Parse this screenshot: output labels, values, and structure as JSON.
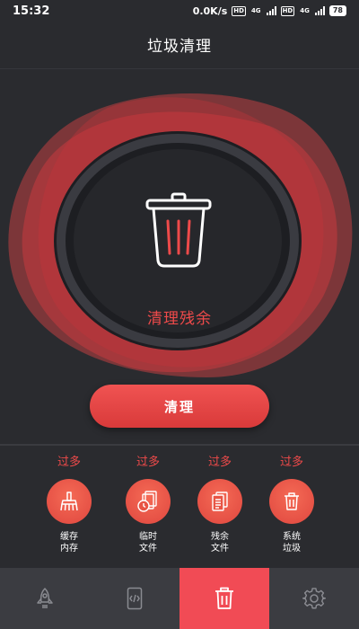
{
  "status_bar": {
    "time": "15:32",
    "speed": "0.0K/s",
    "hd1": "HD",
    "net1": "4G",
    "hd2": "HD",
    "net2": "4G",
    "battery": "78"
  },
  "header": {
    "title": "垃圾清理"
  },
  "hero": {
    "label": "清理残余",
    "icon": "trash-icon"
  },
  "action": {
    "clean_label": "清理"
  },
  "categories": [
    {
      "status": "过多",
      "label_line1": "缓存",
      "label_line2": "内存",
      "icon": "broom-icon"
    },
    {
      "status": "过多",
      "label_line1": "临时",
      "label_line2": "文件",
      "icon": "temp-files-icon"
    },
    {
      "status": "过多",
      "label_line1": "残余",
      "label_line2": "文件",
      "icon": "document-icon"
    },
    {
      "status": "过多",
      "label_line1": "系统",
      "label_line2": "垃圾",
      "icon": "trash-icon"
    }
  ],
  "bottom_nav": [
    {
      "icon": "rocket-icon",
      "active": false
    },
    {
      "icon": "phone-code-icon",
      "active": false
    },
    {
      "icon": "trash-icon",
      "active": true
    },
    {
      "icon": "gear-icon",
      "active": false
    }
  ],
  "colors": {
    "accent": "#ee4a4a",
    "background": "#2a2b2f",
    "nav_active": "#f14b55",
    "nav_bg": "#3b3c41"
  }
}
